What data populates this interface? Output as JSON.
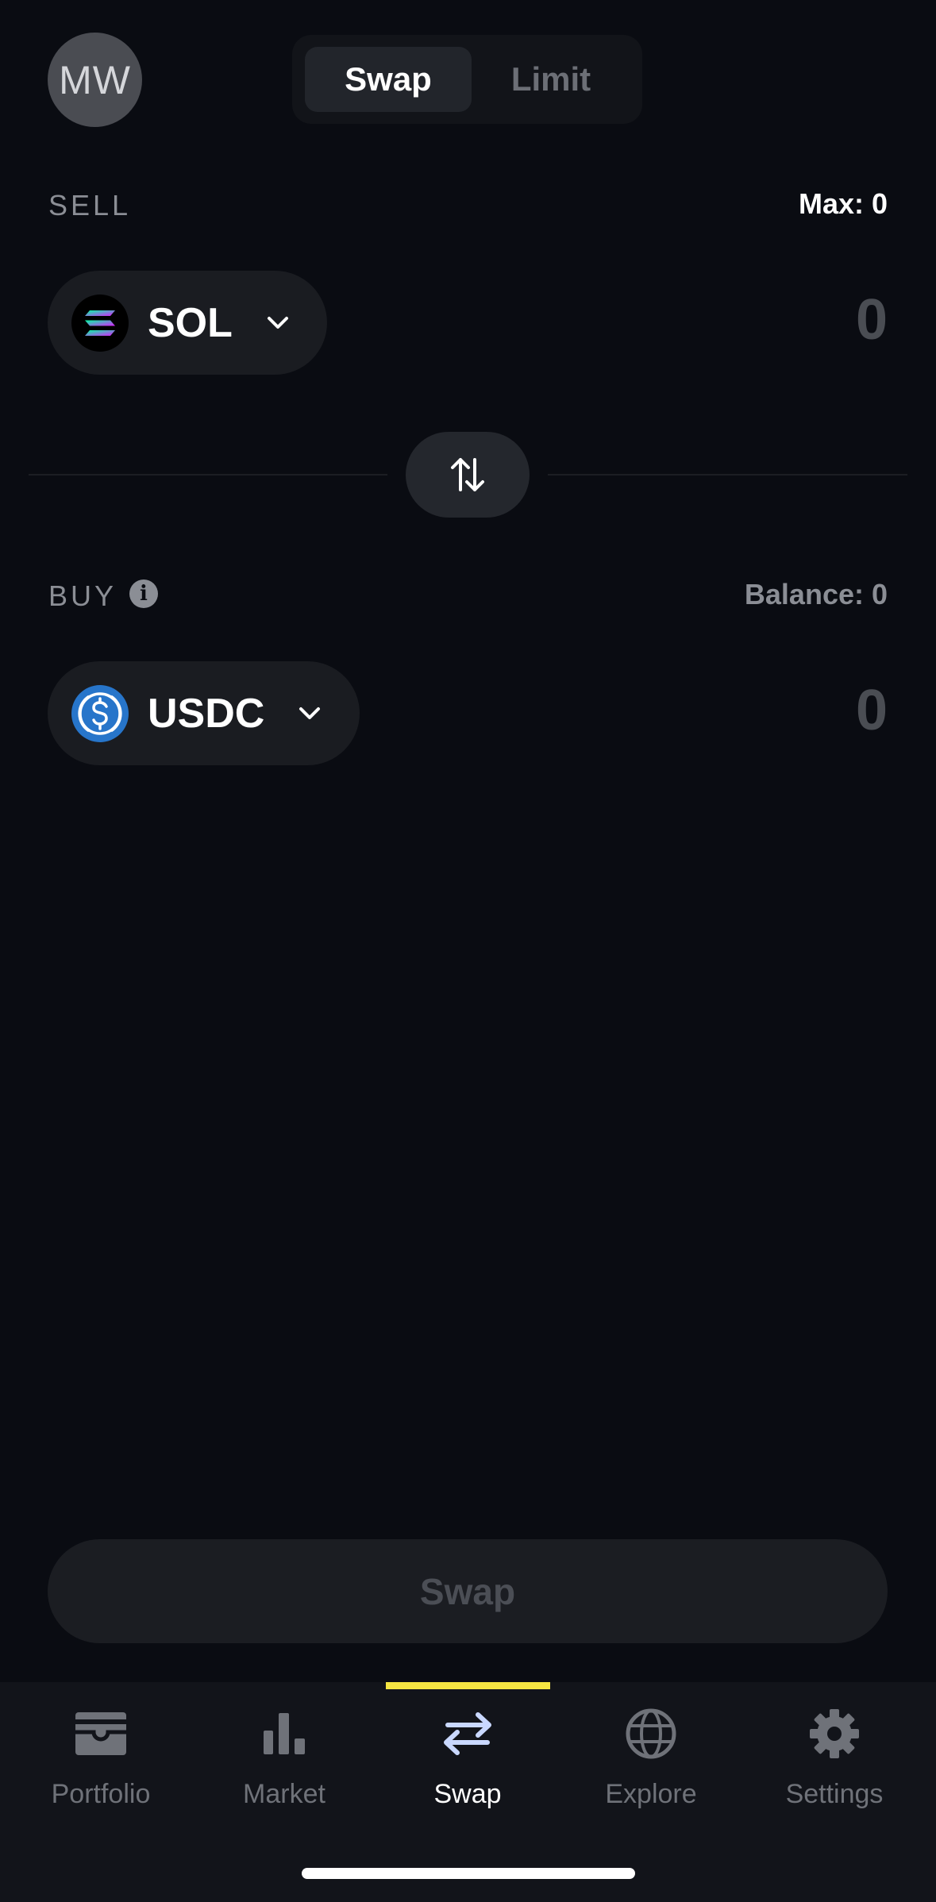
{
  "header": {
    "avatar_initials": "MW",
    "tabs": [
      {
        "label": "Swap",
        "active": true
      },
      {
        "label": "Limit",
        "active": false
      }
    ]
  },
  "sell": {
    "label": "SELL",
    "max_text": "Max: 0",
    "token": "SOL",
    "token_icon": "solana-icon",
    "amount": "0"
  },
  "buy": {
    "label": "BUY",
    "balance_text": "Balance: 0",
    "token": "USDC",
    "token_icon": "usdc-icon",
    "amount": "0"
  },
  "swap_button_label": "Swap",
  "nav": {
    "items": [
      {
        "label": "Portfolio",
        "icon": "wallet-icon",
        "active": false
      },
      {
        "label": "Market",
        "icon": "bar-chart-icon",
        "active": false
      },
      {
        "label": "Swap",
        "icon": "swap-arrows-icon",
        "active": true
      },
      {
        "label": "Explore",
        "icon": "globe-icon",
        "active": false
      },
      {
        "label": "Settings",
        "icon": "gear-icon",
        "active": false
      }
    ]
  },
  "colors": {
    "background": "#0a0c12",
    "accent_indicator": "#f5e642",
    "usdc_blue": "#2775ca"
  }
}
